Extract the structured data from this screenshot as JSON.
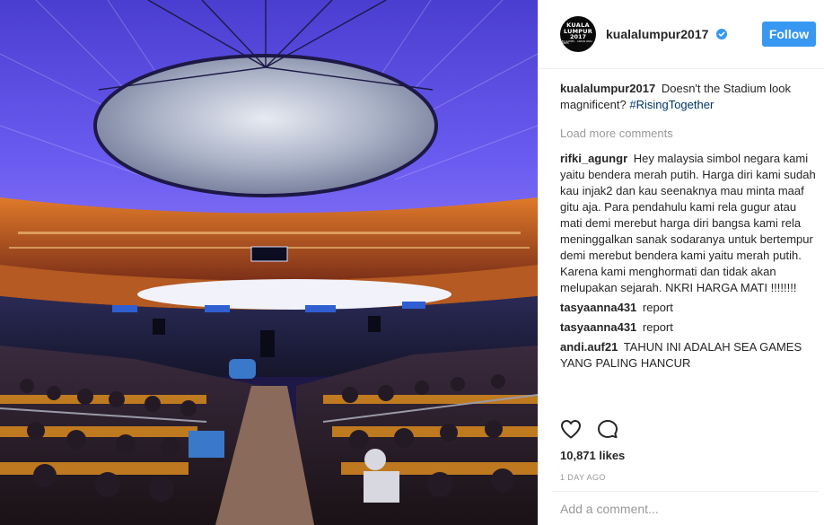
{
  "post": {
    "photo_alt": "stadium-photo",
    "author": "kualalumpur2017",
    "verified": true,
    "follow_label": "Follow",
    "avatar_logo": {
      "line1": "KUALA",
      "line2": "LUMPUR",
      "line3": "2017",
      "line4": "SEA GAMES · ASEAN PARA GAMES"
    }
  },
  "comments": [
    {
      "user": "kualalumpur2017",
      "text": "Doesn't the Stadium look magnificent?",
      "hashtag": "#RisingTogether"
    }
  ],
  "load_more_label": "Load more comments",
  "more_comments": [
    {
      "user": "rifki_agungr",
      "text": "Hey malaysia simbol negara kami yaitu bendera merah putih. Harga diri kami sudah kau injak2 dan kau seenaknya mau minta maaf gitu aja. Para pendahulu kami rela gugur atau mati demi merebut harga diri bangsa kami rela meninggalkan sanak sodaranya untuk bertempur demi merebut bendera kami yaitu merah putih. Karena kami menghormati dan tidak akan melupakan sejarah. NKRI HARGA MATI !!!!!!!!"
    },
    {
      "user": "tasyaanna431",
      "text": "report"
    },
    {
      "user": "tasyaanna431",
      "text": "report"
    },
    {
      "user": "andi.auf21",
      "text": "TAHUN INI ADALAH SEA GAMES YANG PALING HANCUR"
    }
  ],
  "likes_label": "10,871 likes",
  "time_label": "1 DAY AGO",
  "add_comment_placeholder": "Add a comment...",
  "colors": {
    "follow_button": "#3897f0",
    "hashtag": "#003569",
    "muted_text": "#999999",
    "verified_badge": "#3897f0"
  },
  "icons": {
    "like": "heart-icon",
    "comment": "comment-bubble-icon",
    "verified": "verified-badge-icon"
  }
}
